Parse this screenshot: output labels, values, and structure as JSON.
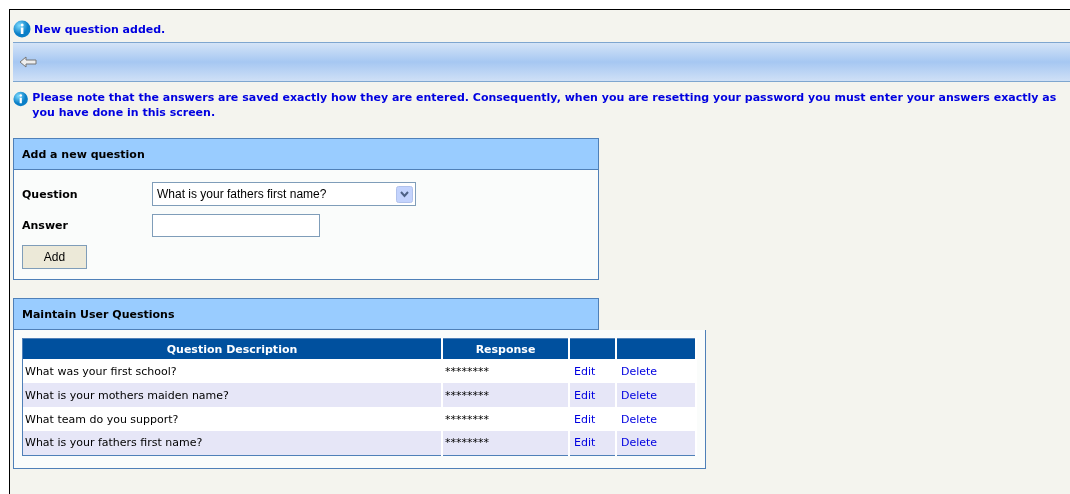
{
  "status_message": "New question added.",
  "note": "Please note that the answers are saved exactly how they are entered. Consequently, when you are resetting your password you must enter your answers exactly as you have done in this screen.",
  "add_panel": {
    "title": "Add a new question",
    "question_label": "Question",
    "question_value": "What is your fathers first name?",
    "answer_label": "Answer",
    "add_button": "Add"
  },
  "maintain_panel": {
    "title": "Maintain User Questions",
    "table": {
      "columns": [
        "Question Description",
        "Response"
      ],
      "rows": [
        {
          "question": "What was your first school?",
          "response": "********",
          "edit": "Edit",
          "delete": "Delete"
        },
        {
          "question": "What is your mothers maiden name?",
          "response": "********",
          "edit": "Edit",
          "delete": "Delete"
        },
        {
          "question": "What team do you support?",
          "response": "********",
          "edit": "Edit",
          "delete": "Delete"
        },
        {
          "question": "What is your fathers first name?",
          "response": "********",
          "edit": "Edit",
          "delete": "Delete"
        }
      ]
    }
  }
}
